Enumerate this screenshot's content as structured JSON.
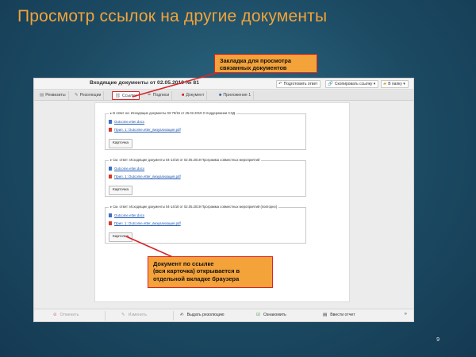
{
  "slide": {
    "title": "Просмотр ссылок на другие документы",
    "page_number": "9"
  },
  "window": {
    "title": "Входящие документы от 02.05.2019 № 81",
    "header_buttons": [
      {
        "icon": "reply-icon",
        "label": "Подготовить ответ"
      },
      {
        "icon": "link-icon",
        "label": "Скопировать ссылку ▾"
      },
      {
        "icon": "folder-icon",
        "label": "В папку ▾"
      }
    ],
    "tabs": [
      {
        "icon": "details-icon",
        "label": "Реквизиты",
        "active": false
      },
      {
        "icon": "resolution-icon",
        "label": "Резолюции",
        "active": false
      },
      {
        "icon": "link-icon",
        "label": "Ссылки",
        "active": true
      },
      {
        "icon": "pen-icon",
        "label": "Подписи",
        "active": false
      },
      {
        "icon": "pdf-icon",
        "label": "Документ",
        "active": false
      },
      {
        "icon": "attachment-icon",
        "label": "Приложение 1",
        "active": false
      }
    ],
    "links": [
      {
        "legend": "В ответ на: Исходящие документы 03-79/15 от 25.02.2019 О поддержании СЭД",
        "files": [
          {
            "type": "doc",
            "name": "Outcome.etter.docx"
          },
          {
            "type": "pdf",
            "name": "Прил. 1: Outcome.etter_визуализация.pdf"
          }
        ],
        "card_label": "Карточка"
      },
      {
        "legend": "См. ответ: Исходящие документы 04-14/16 от 02.05.2019 Программа совместных мероприятий",
        "files": [
          {
            "type": "doc",
            "name": "Outcome.etter.docx"
          },
          {
            "type": "pdf",
            "name": "Прил. 1: Outcome.etter_визуализация.pdf"
          }
        ],
        "card_label": "Карточка"
      },
      {
        "legend": "См. ответ: Исходящие документы 04-14/18 от 02.05.2019 Программа совместных мероприятий (повторно)",
        "files": [
          {
            "type": "doc",
            "name": "Outcome.etter.docx"
          },
          {
            "type": "pdf",
            "name": "Прил. 1: Outcome.etter_визуализация.pdf"
          }
        ],
        "card_label": "Карточка"
      }
    ],
    "footer": [
      {
        "icon": "cancel-icon",
        "label": "Отменить",
        "disabled": true
      },
      {
        "icon": "edit-icon",
        "label": "Изменить",
        "disabled": true
      },
      {
        "icon": "resolution-icon",
        "label": "Выдать резолюцию",
        "disabled": false
      },
      {
        "icon": "check-icon",
        "label": "Ознакомить",
        "disabled": false
      },
      {
        "icon": "report-icon",
        "label": "Ввести отчет",
        "disabled": false
      }
    ],
    "footer_more": "»"
  },
  "callouts": {
    "top": "Закладка для просмотра связанных документов",
    "bottom_line1": "Документ по ссылке",
    "bottom_line2": "(вся карточка) открывается в",
    "bottom_line3": "отдельной вкладке браузера"
  },
  "colors": {
    "accent": "#f2a33a",
    "callout_bg": "#f4a23a",
    "highlight": "#d8242a",
    "background": "#1c4a63"
  }
}
